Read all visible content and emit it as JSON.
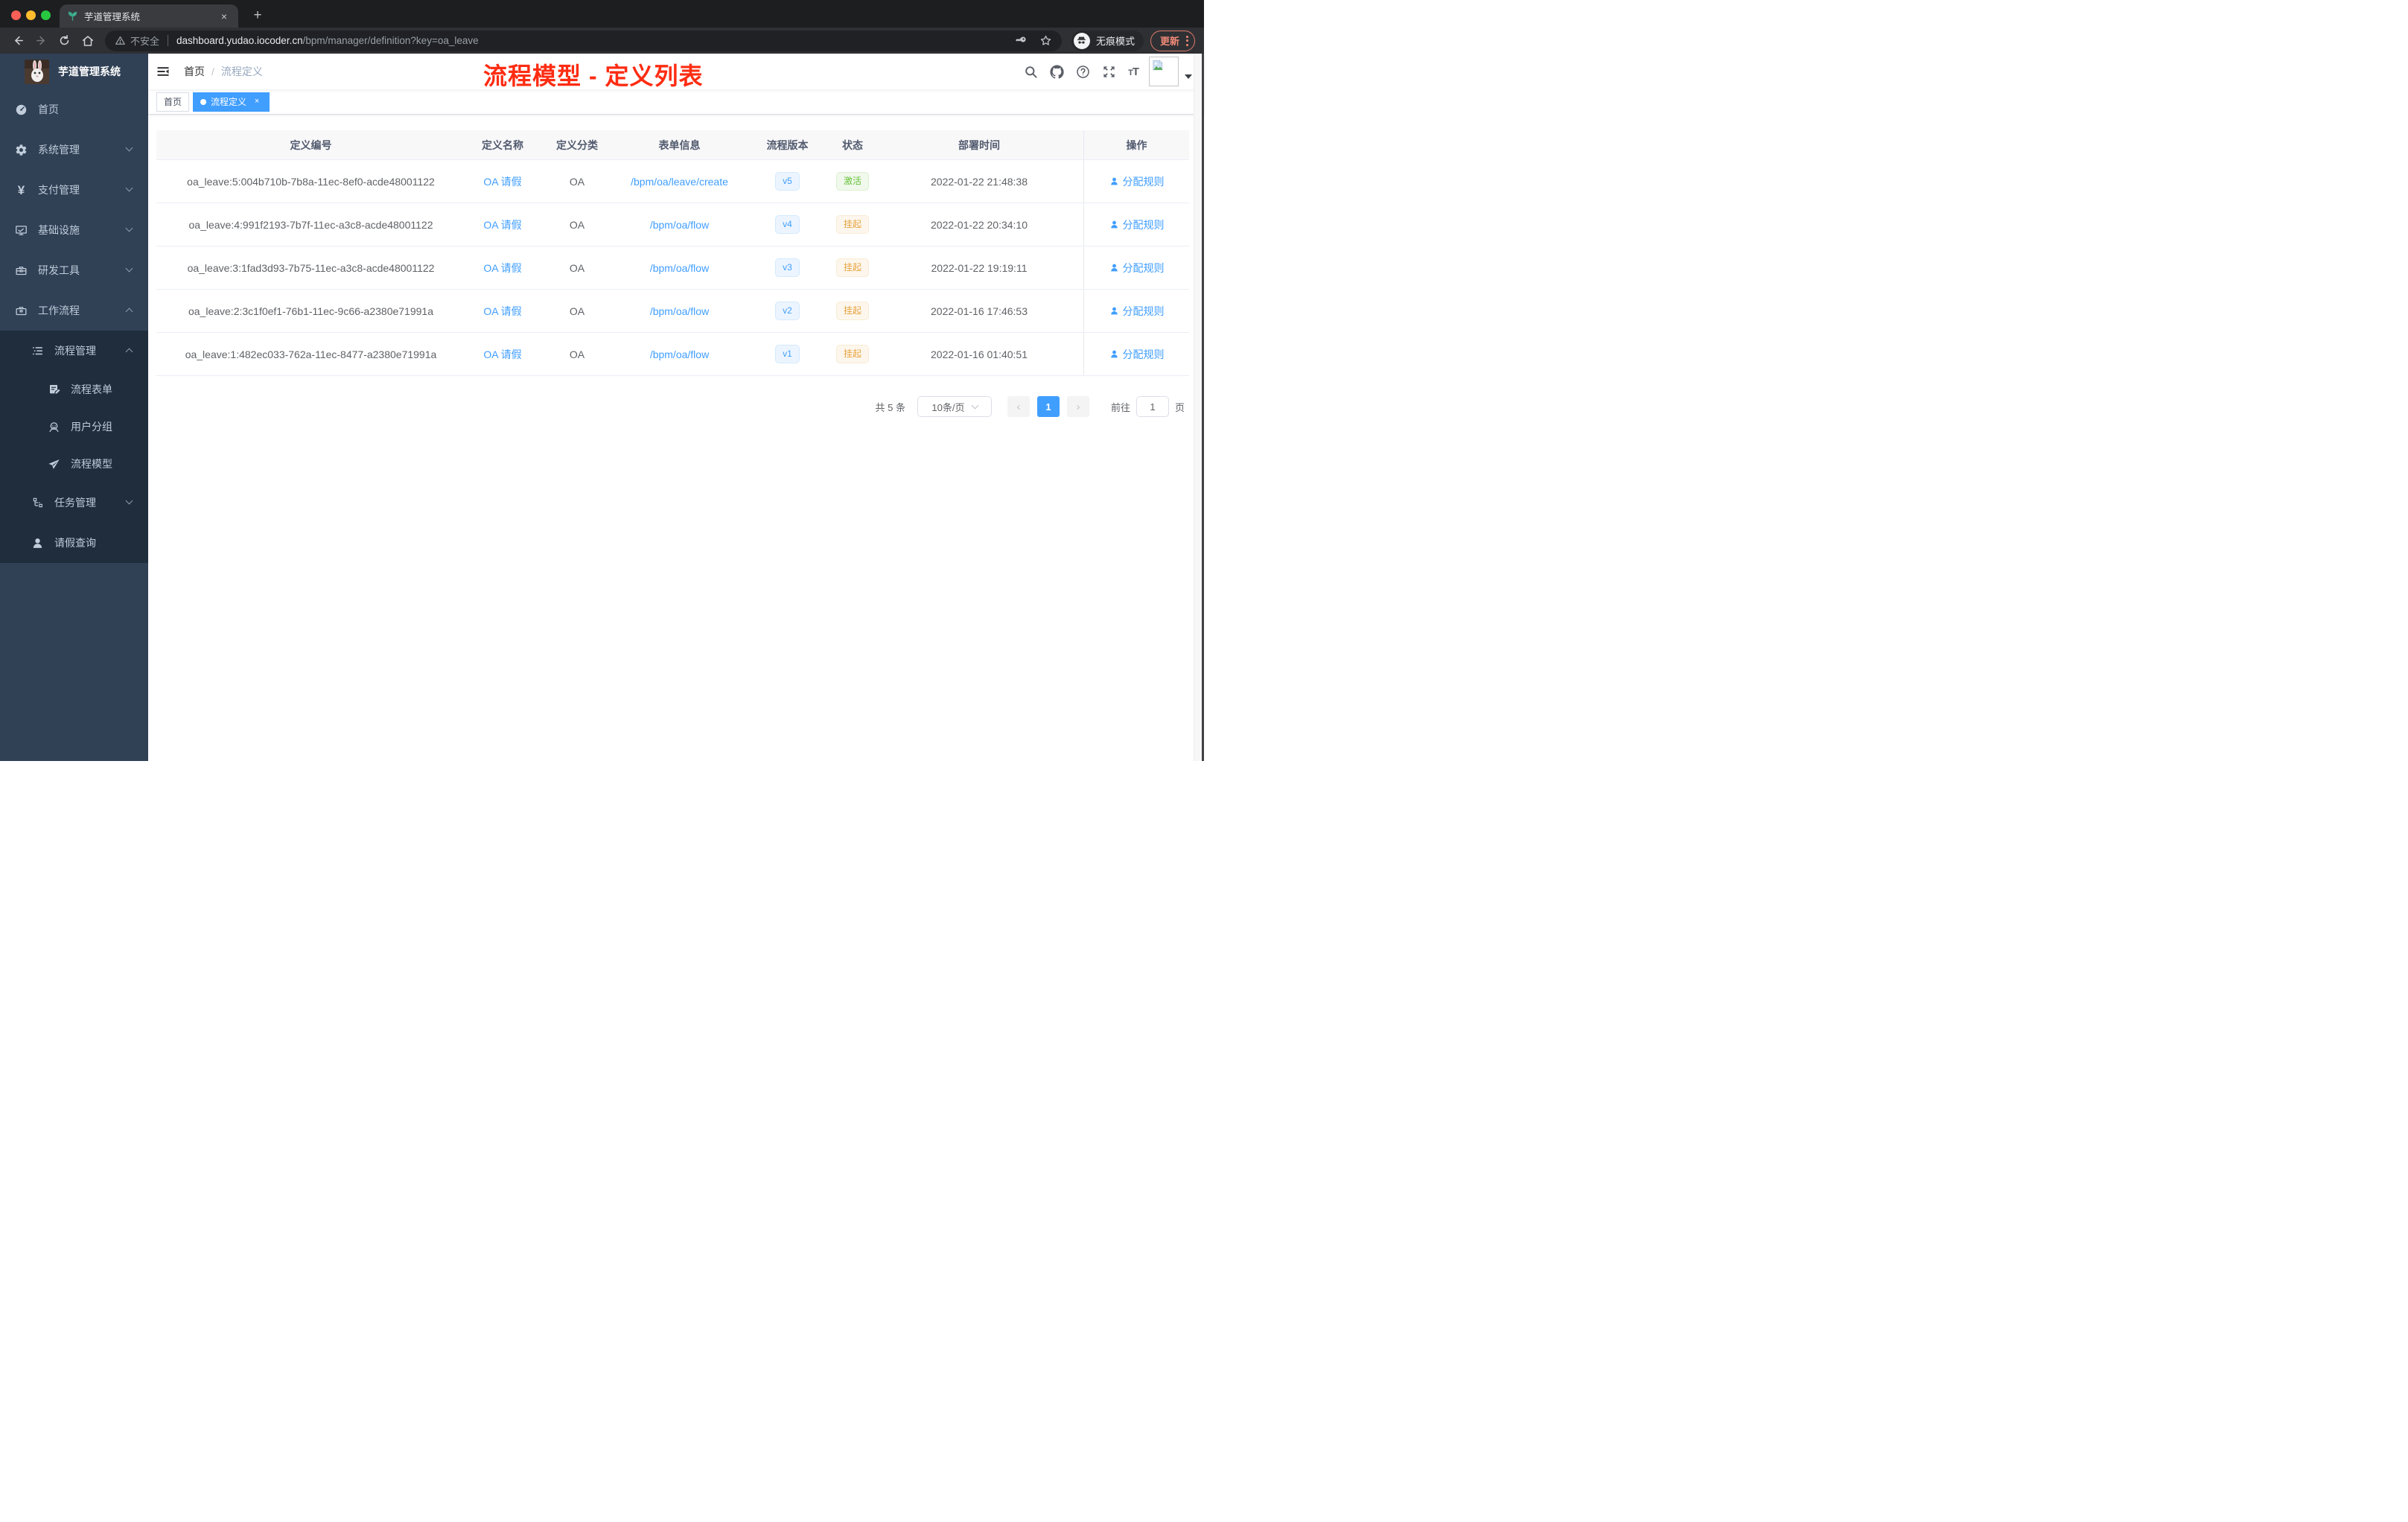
{
  "browser": {
    "tab": {
      "title": "芋道管理系统",
      "close": "×",
      "new_tab": "+"
    },
    "address": {
      "security_label": "不安全",
      "url_host": "dashboard.yudao.iocoder.cn",
      "url_path": "/bpm/manager/definition?key=oa_leave"
    },
    "incognito_label": "无痕模式",
    "update_label": "更新"
  },
  "sidebar": {
    "logo_title": "芋道管理系统",
    "menu": [
      {
        "label": "首页",
        "icon": "dashboard-icon",
        "level": 1
      },
      {
        "label": "系统管理",
        "icon": "gear-icon",
        "level": 1,
        "state": "collapsed"
      },
      {
        "label": "支付管理",
        "icon": "yen-icon",
        "level": 1,
        "state": "collapsed"
      },
      {
        "label": "基础设施",
        "icon": "monitor-icon",
        "level": 1,
        "state": "collapsed"
      },
      {
        "label": "研发工具",
        "icon": "toolbox-icon",
        "level": 1,
        "state": "collapsed"
      },
      {
        "label": "工作流程",
        "icon": "briefcase-icon",
        "level": 1,
        "state": "expanded"
      },
      {
        "label": "流程管理",
        "icon": "list-icon",
        "level": 2,
        "state": "expanded"
      },
      {
        "label": "流程表单",
        "icon": "form-icon",
        "level": 3
      },
      {
        "label": "用户分组",
        "icon": "user-group-icon",
        "level": 3
      },
      {
        "label": "流程模型",
        "icon": "paper-plane-icon",
        "level": 3
      },
      {
        "label": "任务管理",
        "icon": "tree-icon",
        "level": 2,
        "state": "collapsed"
      },
      {
        "label": "请假查询",
        "icon": "person-icon",
        "level": 2
      }
    ]
  },
  "header": {
    "breadcrumb": {
      "home": "首页",
      "separator": "/",
      "current": "流程定义"
    },
    "annotation": "流程模型 - 定义列表"
  },
  "tags": {
    "home": {
      "label": "首页",
      "active": false
    },
    "current": {
      "label": "流程定义",
      "active": true,
      "close": "×"
    }
  },
  "table": {
    "columns": {
      "id": "定义编号",
      "name": "定义名称",
      "category": "定义分类",
      "form": "表单信息",
      "version": "流程版本",
      "status": "状态",
      "deployed_at": "部署时间",
      "action": "操作"
    },
    "rows": [
      {
        "id": "oa_leave:5:004b710b-7b8a-11ec-8ef0-acde48001122",
        "name": "OA 请假",
        "category": "OA",
        "form": "/bpm/oa/leave/create",
        "version": "v5",
        "status": "激活",
        "status_type": "success",
        "deployed_at": "2022-01-22 21:48:38",
        "action": "分配规则"
      },
      {
        "id": "oa_leave:4:991f2193-7b7f-11ec-a3c8-acde48001122",
        "name": "OA 请假",
        "category": "OA",
        "form": "/bpm/oa/flow",
        "version": "v4",
        "status": "挂起",
        "status_type": "warning",
        "deployed_at": "2022-01-22 20:34:10",
        "action": "分配规则"
      },
      {
        "id": "oa_leave:3:1fad3d93-7b75-11ec-a3c8-acde48001122",
        "name": "OA 请假",
        "category": "OA",
        "form": "/bpm/oa/flow",
        "version": "v3",
        "status": "挂起",
        "status_type": "warning",
        "deployed_at": "2022-01-22 19:19:11",
        "action": "分配规则"
      },
      {
        "id": "oa_leave:2:3c1f0ef1-76b1-11ec-9c66-a2380e71991a",
        "name": "OA 请假",
        "category": "OA",
        "form": "/bpm/oa/flow",
        "version": "v2",
        "status": "挂起",
        "status_type": "warning",
        "deployed_at": "2022-01-16 17:46:53",
        "action": "分配规则"
      },
      {
        "id": "oa_leave:1:482ec033-762a-11ec-8477-a2380e71991a",
        "name": "OA 请假",
        "category": "OA",
        "form": "/bpm/oa/flow",
        "version": "v1",
        "status": "挂起",
        "status_type": "warning",
        "deployed_at": "2022-01-16 01:40:51",
        "action": "分配规则"
      }
    ]
  },
  "pagination": {
    "total": "共 5 条",
    "page_size": "10条/页",
    "prev": "‹",
    "current_page": "1",
    "next": "›",
    "goto_label": "前往",
    "goto_value": "1",
    "page_unit": "页"
  },
  "colors": {
    "primary": "#409eff",
    "success": "#67c23a",
    "warning": "#e6a23c",
    "annotation_red": "#fe2c12",
    "sidebar_bg": "#304156",
    "submenu_bg": "#1f2d3d",
    "sidebar_text": "#bfcbd9"
  }
}
